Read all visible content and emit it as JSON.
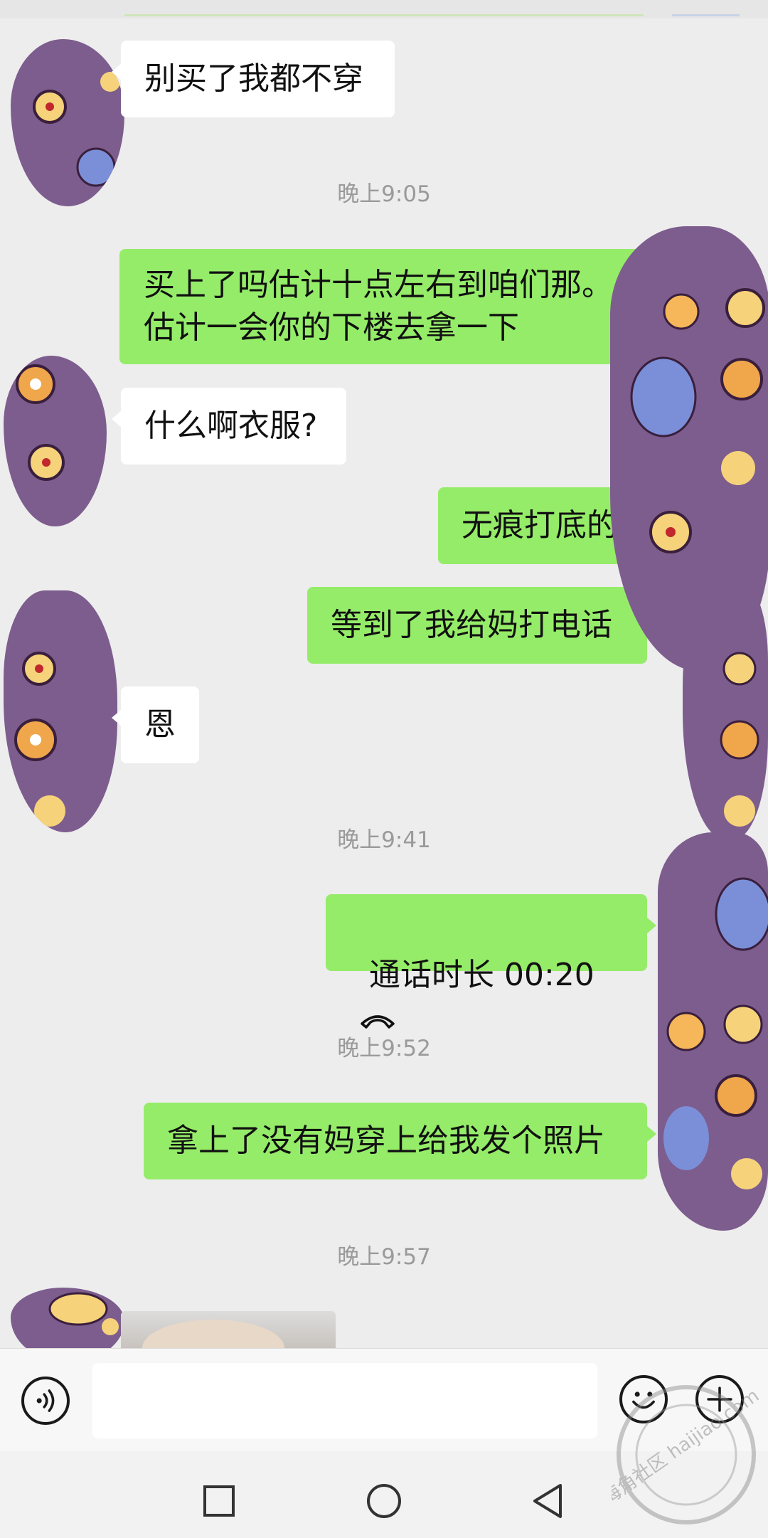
{
  "colors": {
    "background": "#ededed",
    "bubble_sent": "#95ec69",
    "bubble_received": "#ffffff",
    "time_text": "#9a9a9a"
  },
  "messages": [
    {
      "side": "left",
      "text": "别买了我都不穿"
    },
    {
      "time": "晚上9:05"
    },
    {
      "side": "right",
      "text": "买上了吗估计十点左右到咱们那。\n估计一会你的下楼去拿一下"
    },
    {
      "side": "left",
      "text": "什么啊衣服?"
    },
    {
      "side": "right",
      "text": "无痕打底的"
    },
    {
      "side": "right",
      "text": "等到了我给妈打电话"
    },
    {
      "side": "left",
      "text": "恩"
    },
    {
      "time": "晚上9:41"
    },
    {
      "side": "right",
      "text": "通话时长 00:20",
      "icon": "phone-hangup-icon"
    },
    {
      "time": "晚上9:52"
    },
    {
      "side": "right",
      "text": "拿上了没有妈穿上给我发个照片"
    },
    {
      "time": "晚上9:57"
    },
    {
      "side": "left",
      "type": "image"
    }
  ],
  "input_bar": {
    "voice_icon": "voice-icon",
    "text_value": "",
    "emoji_icon": "emoji-icon",
    "plus_icon": "plus-icon"
  },
  "nav_bar": {
    "icons": [
      "recent-apps-icon",
      "home-icon",
      "back-icon"
    ]
  },
  "watermark": {
    "text": "海角社区 haijiao.com"
  }
}
